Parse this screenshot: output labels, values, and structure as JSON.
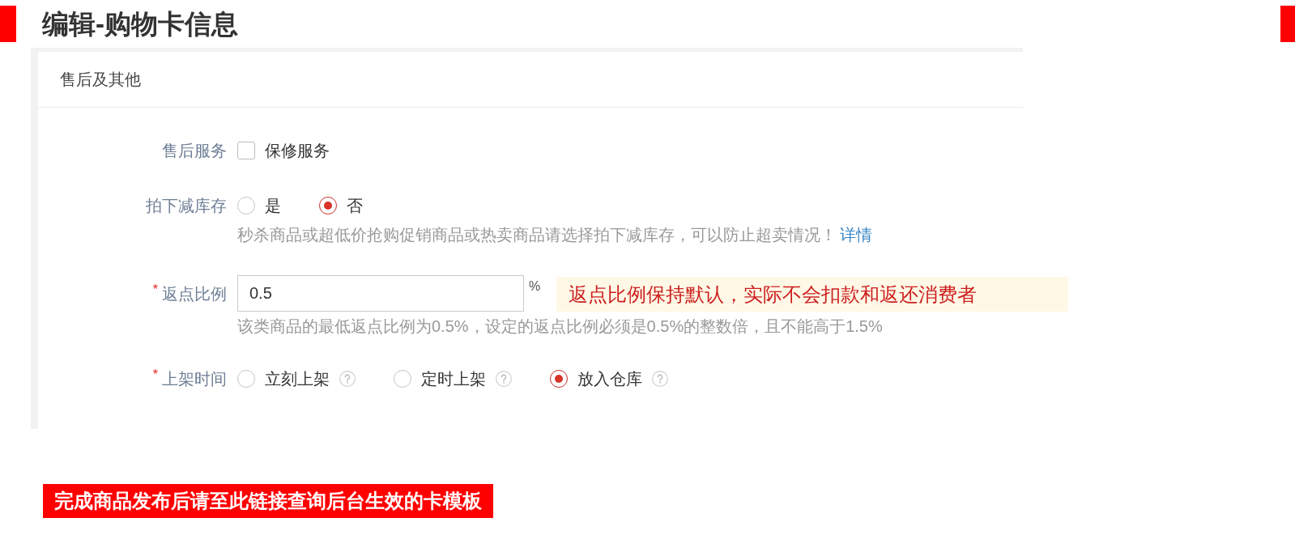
{
  "title": "编辑-购物卡信息",
  "section": {
    "title": "售后及其他",
    "fields": [
      {
        "kind": "checkbox",
        "label": "售后服务",
        "options": [
          {
            "label": "保修服务",
            "checked": false
          }
        ]
      },
      {
        "kind": "radio",
        "label": "拍下减库存",
        "options": [
          {
            "label": "是",
            "selected": false
          },
          {
            "label": "否",
            "selected": true
          }
        ],
        "hint": "秒杀商品或超低价抢购促销商品或热卖商品请选择拍下减库存，可以防止超卖情况！",
        "hint_link": "详情"
      },
      {
        "kind": "input",
        "required_mark": "*",
        "label": "返点比例",
        "value": "0.5",
        "unit": "%",
        "tip": "返点比例保持默认，实际不会扣款和返还消费者",
        "hint": "该类商品的最低返点比例为0.5%，设定的返点比例必须是0.5%的整数倍，且不能高于1.5%"
      },
      {
        "kind": "radio",
        "required_mark": "*",
        "label": "上架时间",
        "options": [
          {
            "label": "立刻上架",
            "selected": false,
            "help_icon": true
          },
          {
            "label": "定时上架",
            "selected": false,
            "help_icon": true
          },
          {
            "label": "放入仓库",
            "selected": true,
            "help_icon": true
          }
        ]
      }
    ]
  },
  "notice": "完成商品发布后请至此链接查询后台生效的卡模板"
}
